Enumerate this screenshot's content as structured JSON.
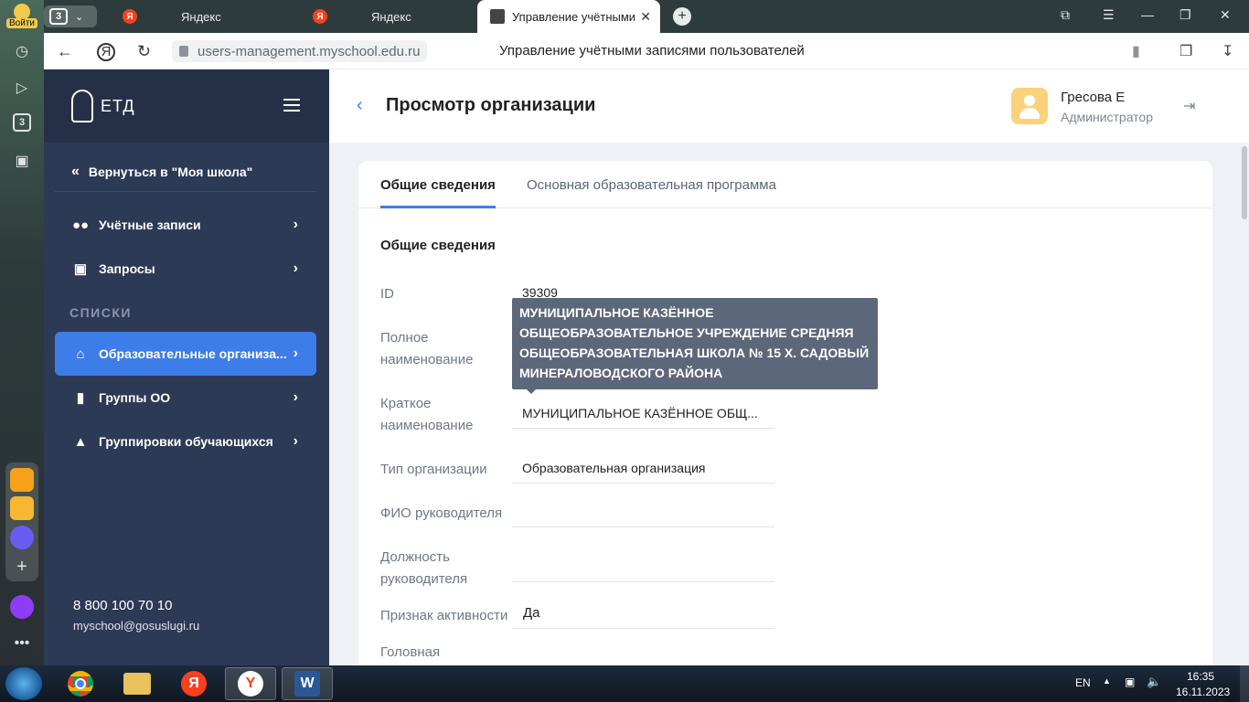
{
  "browser": {
    "login_label": "Войти",
    "tab_count": "3",
    "tabs": [
      {
        "title": "Яндекс",
        "favicon": "Я"
      },
      {
        "title": "Яндекс",
        "favicon": "Я"
      },
      {
        "title": "Управление учётными",
        "favicon": ""
      }
    ],
    "url": "users-management.myschool.edu.ru",
    "page_title": "Управление учётными записями пользователей",
    "rail_badge": "3"
  },
  "sidebar": {
    "logo_text": "ЕТД",
    "back_label": "Вернуться в \"Моя школа\"",
    "items": [
      {
        "label": "Учётные записи",
        "icon": "users-icon"
      },
      {
        "label": "Запросы",
        "icon": "inbox-icon"
      }
    ],
    "section_label": "СПИСКИ",
    "list_items": [
      {
        "label": "Образовательные организа...",
        "icon": "institution-icon"
      },
      {
        "label": "Группы ОО",
        "icon": "bookmark-icon"
      },
      {
        "label": "Группировки обучающихся",
        "icon": "graduation-cap-icon"
      }
    ],
    "phone": "8 800 100 70 10",
    "email": "myschool@gosuslugi.ru"
  },
  "header": {
    "title": "Просмотр организации",
    "user_name": "Гресова Е",
    "user_role": "Администратор"
  },
  "content": {
    "tabs": [
      "Общие сведения",
      "Основная образовательная программа"
    ],
    "section_title": "Общие сведения",
    "fields": [
      {
        "label": "ID",
        "value": "39309"
      },
      {
        "label": "Полное наименование",
        "value": ""
      },
      {
        "label": "Краткое наименование",
        "value": "МУНИЦИПАЛЬНОЕ КАЗЁННОЕ ОБЩ..."
      },
      {
        "label": "Тип организации",
        "value": "Образовательная организация"
      },
      {
        "label": "ФИО руководителя",
        "value": ""
      },
      {
        "label": "Должность руководителя",
        "value": ""
      },
      {
        "label": "Признак активности",
        "value": "Да"
      },
      {
        "label": "Головная",
        "value": ""
      }
    ],
    "tooltip": "МУНИЦИПАЛЬНОЕ КАЗЁННОЕ ОБЩЕОБРАЗОВАТЕЛЬНОЕ УЧРЕЖДЕНИЕ СРЕДНЯЯ ОБЩЕОБРАЗОВАТЕЛЬНАЯ ШКОЛА № 15 Х. САДОВЫЙ МИНЕРАЛОВОДСКОГО РАЙОНА"
  },
  "taskbar": {
    "lang": "EN",
    "time": "16:35",
    "date": "16.11.2023",
    "word_glyph": "W",
    "yandex_glyph": "Я",
    "ybrowser_glyph": "Y"
  },
  "colors": {
    "accent": "#3d7de8",
    "sidebar_bg": "#2d3a55",
    "avatar": "#fbd27c"
  }
}
